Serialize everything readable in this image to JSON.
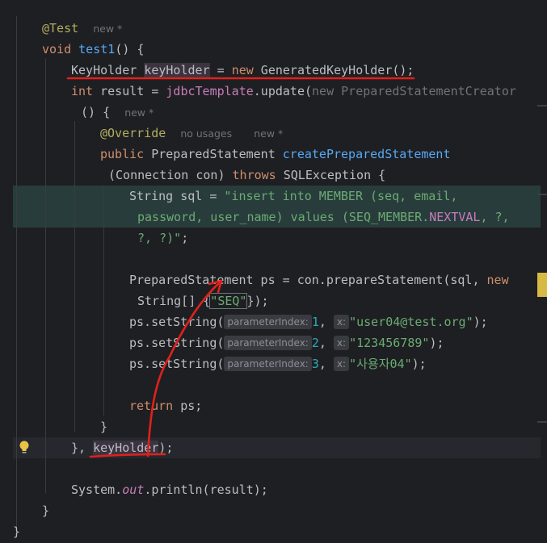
{
  "colors": {
    "background": "#1e1f22",
    "keyword": "#cf8e6d",
    "annotation": "#b3ae60",
    "method": "#56a8f5",
    "string": "#6aab73",
    "number": "#2aacb8",
    "field": "#c77dbb",
    "annotation_red": "#e0211b"
  },
  "lines": {
    "l1_ann": "@Test",
    "l1_hint": "new *",
    "l2_void": "void",
    "l2_name": "test1",
    "l2_rest": "() {",
    "l3_type": "KeyHolder",
    "l3_var": "keyHolder",
    "l3_eq": " = ",
    "l3_new": "new",
    "l3_cls": " GeneratedKeyHolder();",
    "l4_int": "int",
    "l4_mid": " result = ",
    "l4_jdbc": "jdbcTemplate",
    "l4_call": ".update(",
    "l4_new": "new",
    "l4_pse": " PreparedStatementCreator",
    "l5_lambda": "() {",
    "l5_hint": "new *",
    "l6_ann": "@Override",
    "l6_hint1": "no usages",
    "l6_hint2": "new *",
    "l7_public": "public",
    "l7_type": " PreparedStatement ",
    "l7_name": "createPreparedStatement",
    "l8_params": "(Connection con) ",
    "l8_throws": "throws",
    "l8_ex": " SQLException {",
    "l9_pre": "String sql = ",
    "l9_str": "\"insert into MEMBER (seq, email,",
    "l10_str": "password, user_name) values (SEQ_MEMBER.",
    "l10_nextval": "NEXTVAL",
    "l10_str2": ", ?,",
    "l11_str": "?, ?)\"",
    "l11_end": ";",
    "l12_pre": "PreparedStatement ps = con.prepareStatement(sql, ",
    "l12_new": "new",
    "l13_pre": "String[] {",
    "l13_str": "\"SEQ\"",
    "l13_end": "});",
    "set_call": "ps.setString(",
    "hint_param": "parameterIndex:",
    "hint_x": "x:",
    "s1_idx": "1",
    "s1_val": "\"user04@test.org\"",
    "s2_idx": "2",
    "s2_val": "\"123456789\"",
    "s3_idx": "3",
    "s3_val": "\"사용자04\"",
    "s_end": ");",
    "comma": ", ",
    "ret_kw": "return",
    "ret_rest": " ps;",
    "close_brace": "}",
    "l19_pre": "}, ",
    "l19_var": "keyHolder",
    "l19_end": ");",
    "l21_sys": "System.",
    "l21_out": "out",
    "l21_rest": ".println(result);",
    "l22": "}",
    "l23": "}"
  }
}
